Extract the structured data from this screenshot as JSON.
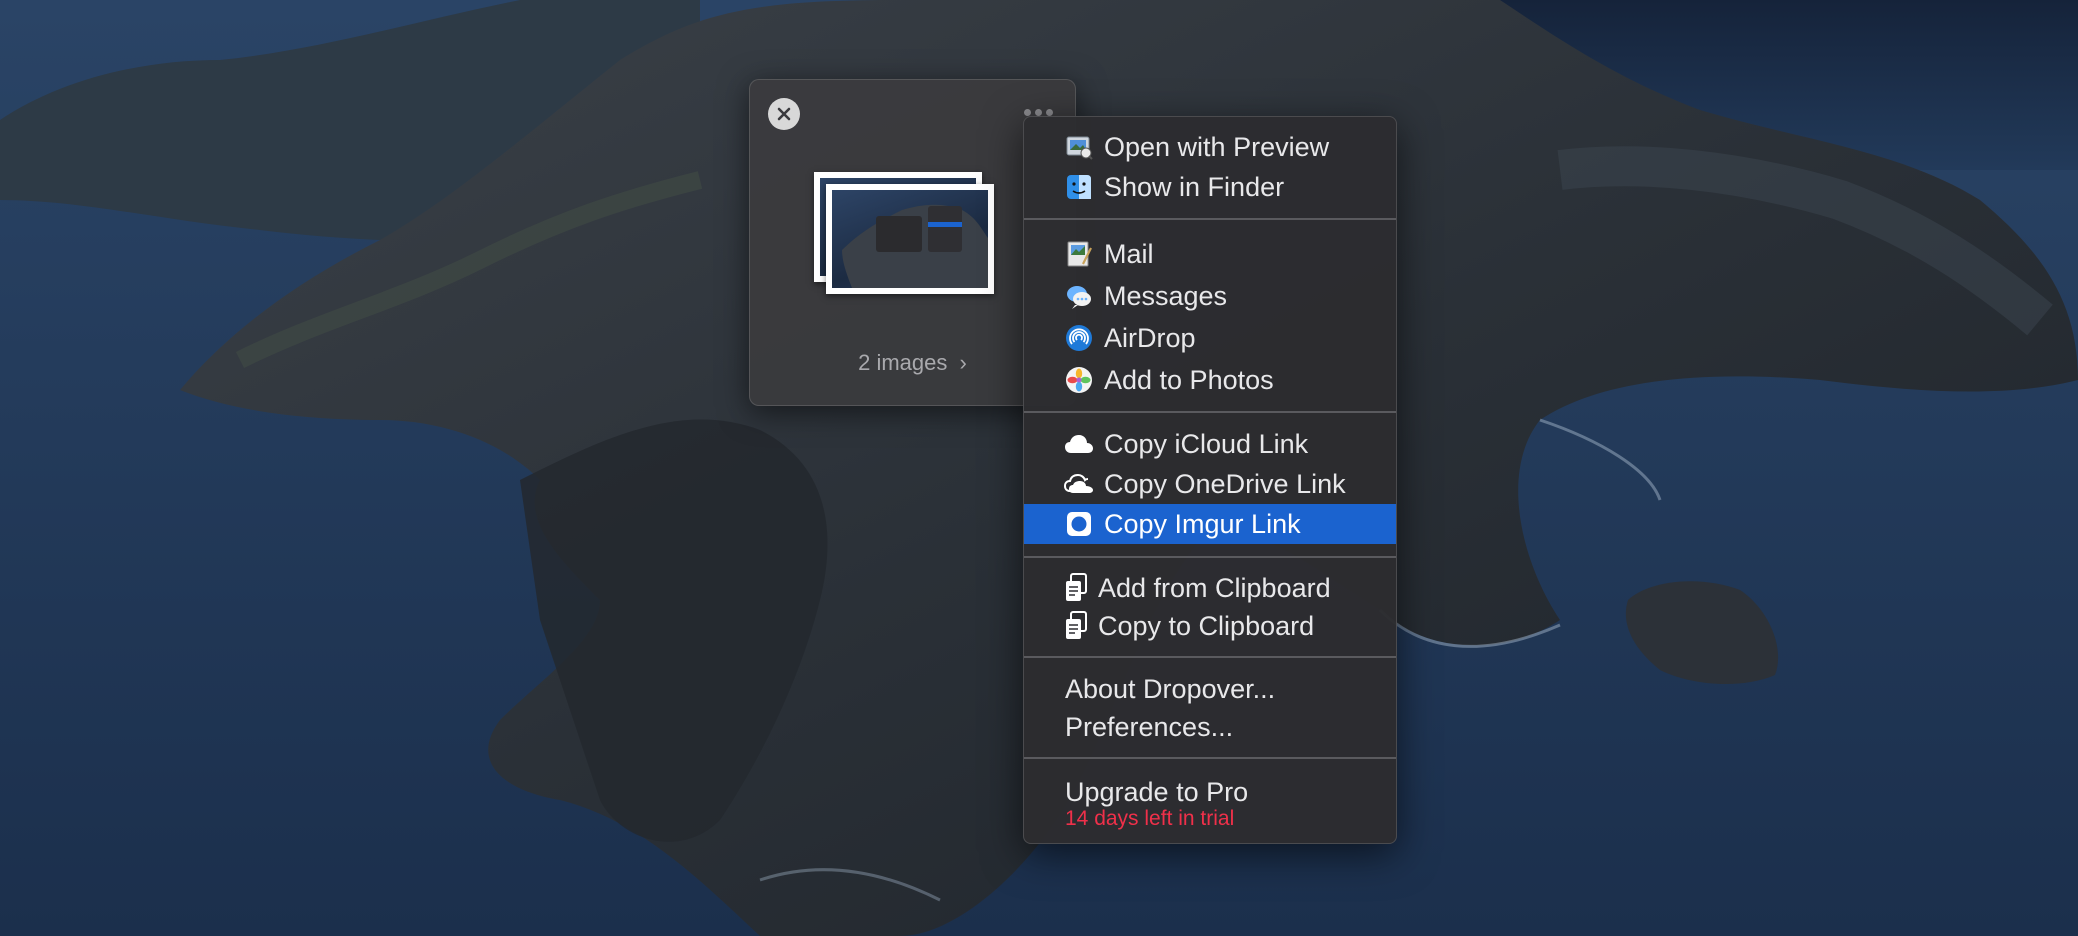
{
  "shelf": {
    "images_link_label": "2 images",
    "chevron_glyph": "›",
    "icons": {
      "close": "close-icon",
      "more": "more-icon"
    }
  },
  "menu": {
    "groups": [
      [
        {
          "label": "Open with Preview",
          "icon": "preview-app-icon"
        },
        {
          "label": "Show in Finder",
          "icon": "finder-icon"
        }
      ],
      [
        {
          "label": "Mail",
          "icon": "mail-icon"
        },
        {
          "label": "Messages",
          "icon": "messages-icon"
        },
        {
          "label": "AirDrop",
          "icon": "airdrop-icon"
        },
        {
          "label": "Add to Photos",
          "icon": "photos-icon"
        }
      ],
      [
        {
          "label": "Copy iCloud Link",
          "icon": "icloud-icon"
        },
        {
          "label": "Copy OneDrive Link",
          "icon": "onedrive-icon"
        },
        {
          "label": "Copy Imgur Link",
          "icon": "imgur-icon",
          "selected": true
        }
      ],
      [
        {
          "label": "Add from Clipboard",
          "icon": "clipboard-icon"
        },
        {
          "label": "Copy to Clipboard",
          "icon": "clipboard-icon"
        }
      ],
      [
        {
          "label": "About Dropover..."
        },
        {
          "label": "Preferences..."
        }
      ],
      [
        {
          "label": "Upgrade to Pro"
        }
      ]
    ],
    "trial_note": "14 days left in trial"
  },
  "colors": {
    "selection": "#1b63cf",
    "trial_note": "#f0304a",
    "menu_bg": "#2c2c30"
  }
}
